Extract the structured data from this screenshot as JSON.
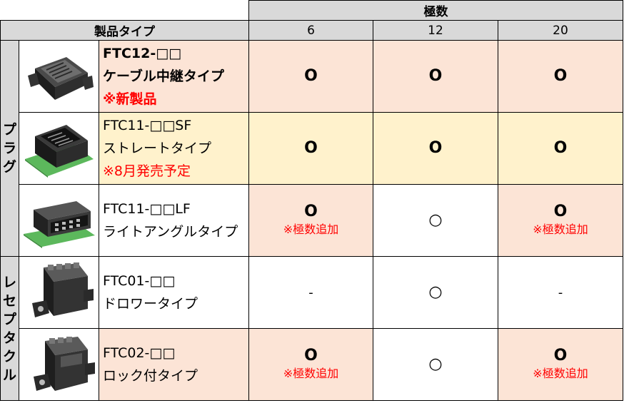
{
  "header": {
    "poles_label": "極数",
    "product_type_label": "製品タイプ",
    "pole_counts": [
      "6",
      "12",
      "20"
    ]
  },
  "categories": {
    "plug": [
      "プ",
      "ラ",
      "グ"
    ],
    "receptacle": [
      "レ",
      "セ",
      "プ",
      "タ",
      "ク",
      "ル"
    ]
  },
  "rows": [
    {
      "model": "FTC12-□□",
      "type_name": "ケーブル中継タイプ",
      "note": "※新製品",
      "icon": "cable-relay-plug-connector-icon",
      "cells": [
        {
          "mark": "O",
          "note": ""
        },
        {
          "mark": "O",
          "note": ""
        },
        {
          "mark": "O",
          "note": ""
        }
      ]
    },
    {
      "model": "FTC11-□□SF",
      "type_name": "ストレートタイプ",
      "note": "※8月発売予定",
      "icon": "straight-plug-connector-icon",
      "cells": [
        {
          "mark": "O",
          "note": ""
        },
        {
          "mark": "O",
          "note": ""
        },
        {
          "mark": "O",
          "note": ""
        }
      ]
    },
    {
      "model": "FTC11-□□LF",
      "type_name": "ライトアングルタイプ",
      "icon": "right-angle-plug-connector-icon",
      "cells": [
        {
          "mark": "O",
          "note": "※極数追加"
        },
        {
          "mark": "○",
          "note": ""
        },
        {
          "mark": "O",
          "note": "※極数追加"
        }
      ]
    },
    {
      "model": "FTC01-□□",
      "type_name": "ドロワータイプ",
      "icon": "drawer-receptacle-connector-icon",
      "cells": [
        {
          "mark": "-",
          "note": ""
        },
        {
          "mark": "○",
          "note": ""
        },
        {
          "mark": "-",
          "note": ""
        }
      ]
    },
    {
      "model": "FTC02-□□",
      "type_name": "ロック付タイプ",
      "icon": "locking-receptacle-connector-icon",
      "cells": [
        {
          "mark": "O",
          "note": "※極数追加"
        },
        {
          "mark": "○",
          "note": ""
        },
        {
          "mark": "O",
          "note": "※極数追加"
        }
      ]
    }
  ],
  "colors": {
    "header_gray": "#d9d9d9",
    "pink": "#fce4d6",
    "yellow": "#fff2cc",
    "red": "#ff0000",
    "pcb_green": "#5cb85c"
  }
}
